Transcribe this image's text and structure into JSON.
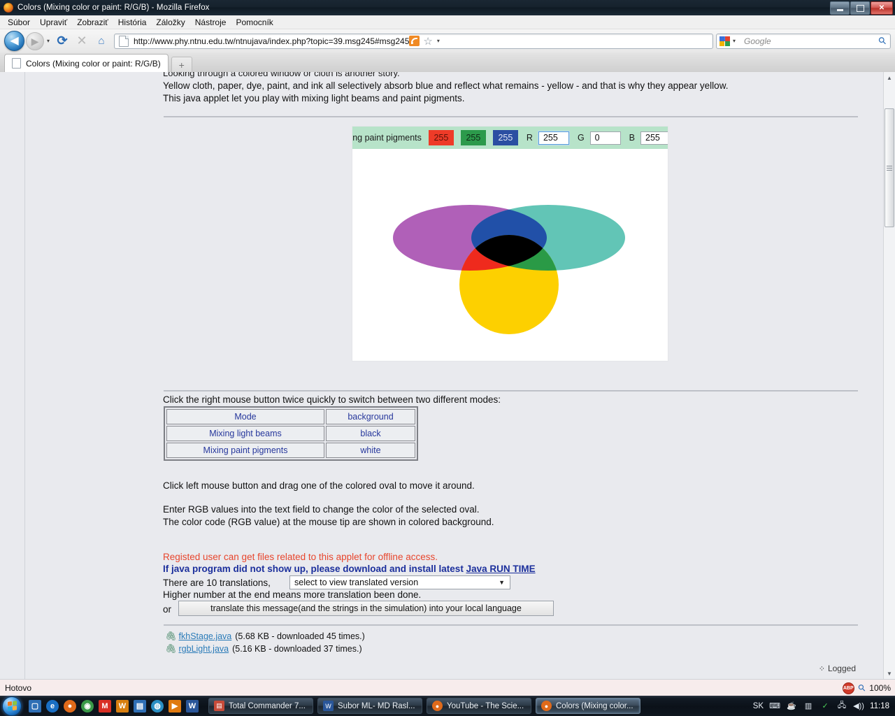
{
  "window": {
    "title": "Colors (Mixing color or paint: R/G/B) - Mozilla Firefox",
    "minimize_label": "Minimize",
    "maximize_label": "Restore",
    "close_label": "✕"
  },
  "menubar": [
    {
      "label": "Súbor"
    },
    {
      "label": "Upraviť"
    },
    {
      "label": "Zobraziť"
    },
    {
      "label": "História"
    },
    {
      "label": "Záložky"
    },
    {
      "label": "Nástroje"
    },
    {
      "label": "Pomocník"
    }
  ],
  "toolbar": {
    "back": "◀",
    "forward": "▶",
    "dropdown": "▾",
    "reload": "⟳",
    "stop": "✕",
    "home": "⌂",
    "url": "http://www.phy.ntnu.edu.tw/ntnujava/index.php?topic=39.msg245#msg245",
    "star": "☆",
    "feed_caret": "▾",
    "search_placeholder": "Google",
    "search_value": "",
    "search_caret": "▾",
    "search_go": "⚲"
  },
  "tabs": {
    "items": [
      {
        "label": "Colors (Mixing color or paint: R/G/B)"
      }
    ],
    "new_tab": "+"
  },
  "page": {
    "line_clipped": "Looking through a colored window or cloth is another story.",
    "paragraph": [
      " Yellow cloth, paper, dye, paint, and ink all selectively absorb blue and reflect what remains - yellow - and that is why they appear yellow.",
      "This java applet let you play with mixing light beams and paint pigments."
    ],
    "applet": {
      "mode_label": "mixing paint pigments",
      "swatches": [
        {
          "name": "red-swatch",
          "value": "255",
          "color": "#ee3b28"
        },
        {
          "name": "green-swatch",
          "value": "255",
          "color": "#2c9a4b"
        },
        {
          "name": "blue-swatch",
          "value": "255",
          "color": "#2b4fa2"
        }
      ],
      "channels": [
        {
          "label": "R",
          "value": "255",
          "focused": true
        },
        {
          "label": "G",
          "value": "0",
          "focused": false
        },
        {
          "label": "B",
          "value": "255",
          "focused": false
        }
      ]
    },
    "modes_intro": "Click the right mouse button twice quickly to switch between two different modes:",
    "mode_table": {
      "headers": [
        "Mode",
        "background"
      ],
      "rows": [
        [
          "Mixing light beams",
          "black"
        ],
        [
          "Mixing paint pigments",
          "white"
        ]
      ]
    },
    "instructions": [
      "Click left mouse button and drag one of the colored oval to move it around.",
      "Enter RGB values into the text field to change the color of the selected oval.",
      "The color code (RGB value) at the mouse tip are shown in colored background."
    ],
    "notice_red": "Registed user can get files related to this applet for offline access.",
    "notice_blue": "If java program did not show up, please download and install latest ",
    "notice_link": "Java RUN TIME",
    "translations_prefix": "There are 10 translations,",
    "translations_select": "select to view translated version",
    "translations_caret": "▼",
    "translations_note": "Higher number at the end means more translation been done.",
    "or_label": "or",
    "translate_button": "translate this message(and the strings in the simulation) into your local language",
    "attachments": [
      {
        "icon": "paperclip-icon",
        "link": "fkhStage.java",
        "meta": "(5.68 KB - downloaded 45 times.)"
      },
      {
        "icon": "paperclip-icon",
        "link": "rgbLight.java",
        "meta": "(5.16 KB - downloaded 37 times.)"
      }
    ],
    "logged_label": "Logged"
  },
  "canvas_shapes": {
    "magenta": "#b060b8",
    "cyan": "#62c5b6",
    "yellow": "#fdd000",
    "red": "#ef2a1d",
    "green": "#2a9a46",
    "blue": "#2150a8",
    "black": "#000000"
  },
  "scrollbar": {
    "up": "▲",
    "down": "▼"
  },
  "statusbar": {
    "status": "Hotovo",
    "adblock": "ABP",
    "zoom_icon": "⚲",
    "zoom_level": "100%"
  },
  "taskbar": {
    "start_label": "Start",
    "quicklaunch": [
      {
        "name": "show-desktop-icon",
        "glyph": "▢",
        "color": "#2f6fb5"
      },
      {
        "name": "internet-explorer-icon",
        "glyph": "e",
        "color": "#1a6fc4"
      },
      {
        "name": "firefox-icon",
        "glyph": "●",
        "color": "#e06a1a"
      },
      {
        "name": "chrome-icon",
        "glyph": "◉",
        "color": "#3a9a48"
      },
      {
        "name": "gmail-icon",
        "glyph": "M",
        "color": "#d93025"
      },
      {
        "name": "winamp-icon",
        "glyph": "W",
        "color": "#d87f10"
      },
      {
        "name": "save-icon",
        "glyph": "▤",
        "color": "#2f6fb5"
      },
      {
        "name": "globe-icon",
        "glyph": "◍",
        "color": "#2a8fc4"
      },
      {
        "name": "media-player-icon",
        "glyph": "▶",
        "color": "#e07a10"
      },
      {
        "name": "word-icon",
        "glyph": "W",
        "color": "#2a5699"
      }
    ],
    "tasks": [
      {
        "label": "Total Commander 7...",
        "icon_glyph": "▤",
        "icon_color": "#c64b3a",
        "active": false
      },
      {
        "label": "Subor ML- MD Rasl...",
        "icon_glyph": "W",
        "icon_color": "#2a5699",
        "active": false
      },
      {
        "label": "YouTube - The Scie...",
        "icon_glyph": "●",
        "icon_color": "#e06a1a",
        "active": false
      },
      {
        "label": "Colors (Mixing color...",
        "icon_glyph": "●",
        "icon_color": "#e06a1a",
        "active": true
      }
    ],
    "tray": {
      "language": "SK",
      "keyboard_icon": "⌨",
      "java_icon": "☕",
      "windows_icon": "▥",
      "security_icon": "✓",
      "network_icon": "🖧",
      "volume_icon": "◀))",
      "clock": "11:18"
    }
  }
}
